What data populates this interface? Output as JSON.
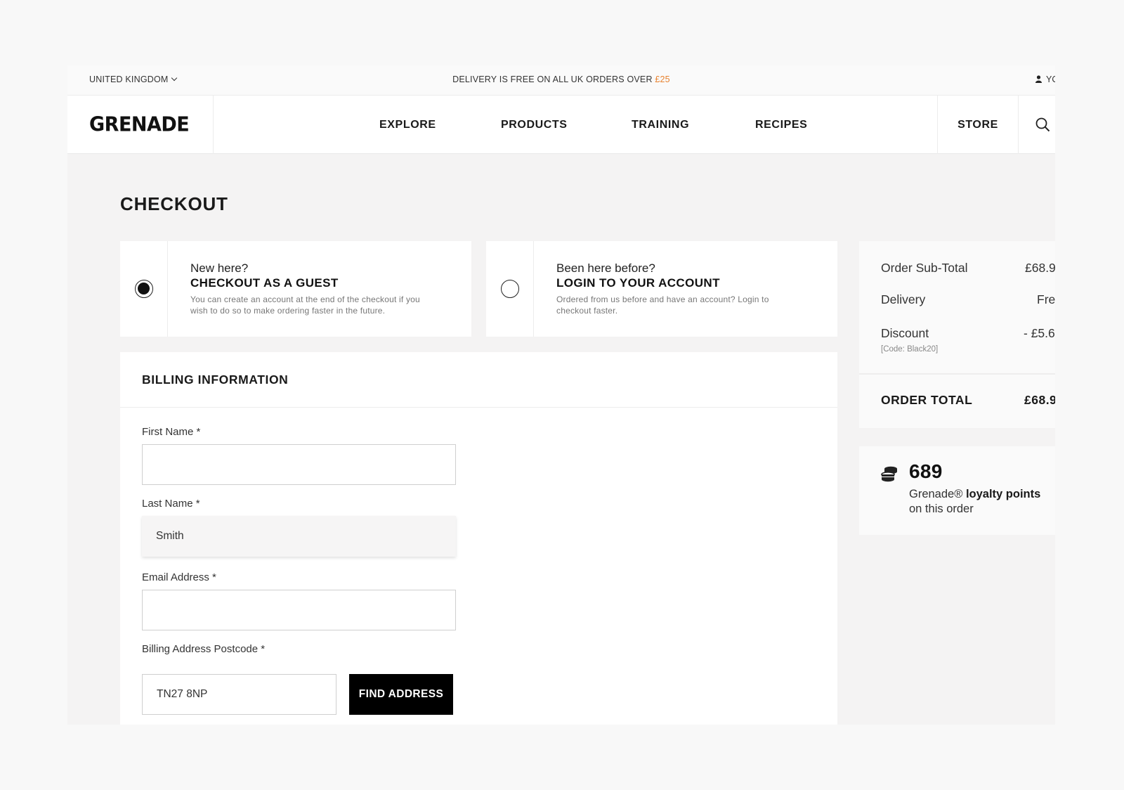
{
  "topbar": {
    "region": "UNITED KINGDOM",
    "promo_text": "DELIVERY IS FREE ON ALL UK ORDERS OVER",
    "promo_amount": "£25",
    "account_label": "YO"
  },
  "header": {
    "logo": "GRENADE",
    "nav": [
      "EXPLORE",
      "PRODUCTS",
      "TRAINING",
      "RECIPES"
    ],
    "store": "STORE"
  },
  "page": {
    "title": "CHECKOUT"
  },
  "options": {
    "guest": {
      "question": "New here?",
      "heading": "CHECKOUT AS A GUEST",
      "description": "You can create an account at the end of the checkout if you wish to do so to make ordering faster in the future.",
      "selected": true
    },
    "login": {
      "question": "Been here before?",
      "heading": "LOGIN TO YOUR ACCOUNT",
      "description": "Ordered from us before and have an account? Login to checkout faster.",
      "selected": false
    }
  },
  "billing": {
    "title": "BILLING INFORMATION",
    "first_name": {
      "label": "First Name *",
      "value": ""
    },
    "last_name": {
      "label": "Last Name *",
      "value": "Smith"
    },
    "email": {
      "label": "Email Address *",
      "value": ""
    },
    "postcode": {
      "label": "Billing Address Postcode *",
      "value": "TN27 8NP"
    },
    "find_button": "FIND ADDRESS"
  },
  "summary": {
    "subtotal_label": "Order Sub-Total",
    "subtotal_value": "£68.9",
    "delivery_label": "Delivery",
    "delivery_value": "Fre",
    "discount_label": "Discount",
    "discount_value": "- £5.6",
    "discount_code": "[Code: Black20]",
    "total_label": "ORDER TOTAL",
    "total_value": "£68.9"
  },
  "loyalty": {
    "points": "689",
    "line1_prefix": "Grenade® ",
    "line1_bold": "loyalty points",
    "line2": "on this order"
  },
  "icons": [
    "chevron-down-icon",
    "person-icon",
    "search-icon",
    "coins-icon"
  ]
}
